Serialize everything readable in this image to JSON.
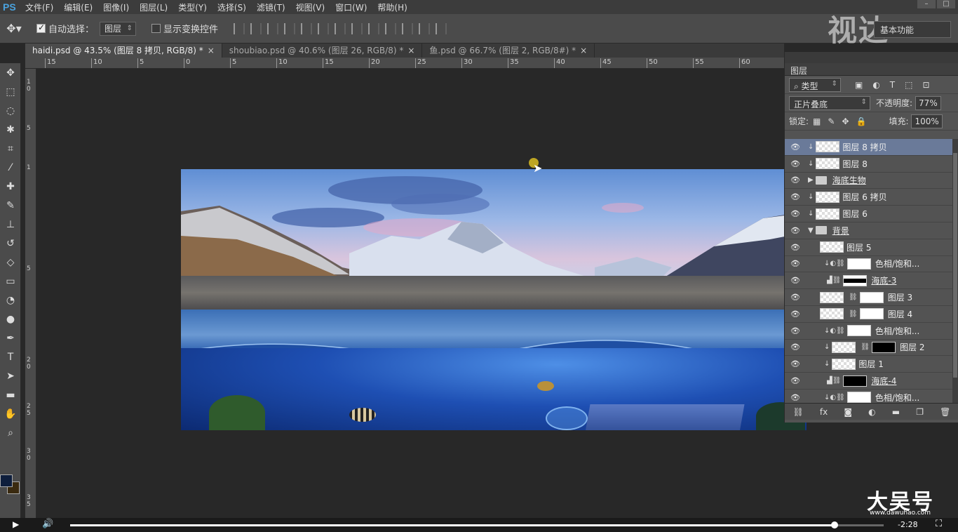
{
  "app": {
    "logo": "PS"
  },
  "menu": [
    "文件(F)",
    "编辑(E)",
    "图像(I)",
    "图层(L)",
    "类型(Y)",
    "选择(S)",
    "滤镜(T)",
    "视图(V)",
    "窗口(W)",
    "帮助(H)"
  ],
  "options": {
    "auto_select_label": "自动选择：",
    "auto_select_value": "图层",
    "show_transform_label": "显示变换控件",
    "workspace": "基本功能"
  },
  "watermark_top": "视达",
  "tabs": [
    {
      "label": "haidi.psd @ 43.5% (图层 8 拷贝, RGB/8) *",
      "active": true
    },
    {
      "label": "shoubiao.psd @ 40.6% (图层 26, RGB/8) *",
      "active": false
    },
    {
      "label": "鱼.psd @ 66.7% (图层 2, RGB/8#) *",
      "active": false
    }
  ],
  "ruler_h": [
    "15",
    "10",
    "5",
    "0",
    "5",
    "10",
    "15",
    "20",
    "25",
    "30",
    "35",
    "40",
    "45",
    "50",
    "55",
    "60"
  ],
  "ruler_v": [
    "1",
    "0",
    "5",
    "1",
    "5",
    "2",
    "0",
    "2",
    "5",
    "3",
    "0",
    "3",
    "5"
  ],
  "layers_panel": {
    "title": "图层",
    "filter": "类型",
    "blend_mode": "正片叠底",
    "opacity_label": "不透明度:",
    "opacity": "77%",
    "lock_label": "锁定:",
    "fill_label": "填充:",
    "fill": "100%",
    "layers": [
      {
        "name": "图层 8 拷贝",
        "type": "pixel",
        "selected": true
      },
      {
        "name": "图层 8",
        "type": "pixel"
      },
      {
        "name": "海底生物",
        "type": "group"
      },
      {
        "name": "图层 6 拷贝",
        "type": "pixel"
      },
      {
        "name": "图层 6",
        "type": "pixel"
      },
      {
        "name": "背景",
        "type": "group-open"
      },
      {
        "name": "图层 5",
        "type": "pixel"
      },
      {
        "name": "色相/饱和...",
        "type": "adjust"
      },
      {
        "name": "海底-3",
        "type": "levels"
      },
      {
        "name": "图层 3",
        "type": "masked"
      },
      {
        "name": "图层 4",
        "type": "masked"
      },
      {
        "name": "色相/饱和...",
        "type": "adjust"
      },
      {
        "name": "图层 2",
        "type": "masked"
      },
      {
        "name": "图层 1",
        "type": "pixel"
      },
      {
        "name": "海底-4",
        "type": "levels"
      },
      {
        "name": "色相/饱和...",
        "type": "adjust"
      }
    ]
  },
  "video": {
    "time": "-2:28",
    "progress": 0.94
  },
  "watermark_bottom": "大吴号",
  "watermark_url": "www.dawuhao.com",
  "colors": {
    "fg": "#0e1e3c",
    "bg": "#3a2a10",
    "selected_layer": "#6a7a99"
  }
}
